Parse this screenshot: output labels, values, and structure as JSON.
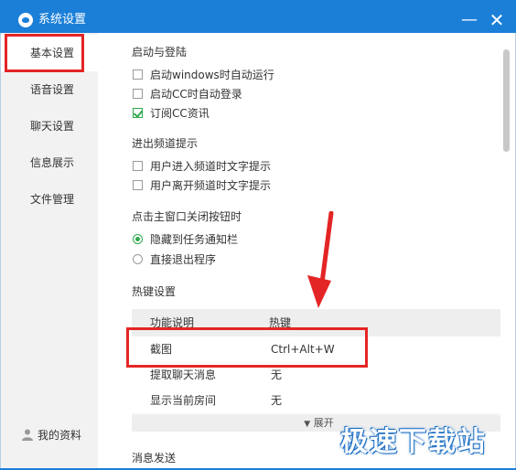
{
  "window": {
    "title": "系统设置"
  },
  "controls": {
    "minimize": "—",
    "close": "✕"
  },
  "sidebar": {
    "items": [
      {
        "label": "基本设置"
      },
      {
        "label": "语音设置"
      },
      {
        "label": "聊天设置"
      },
      {
        "label": "信息展示"
      },
      {
        "label": "文件管理"
      }
    ],
    "profile": "我的资料"
  },
  "sections": {
    "startup": {
      "title": "启动与登陆",
      "options": [
        "启动windows时自动运行",
        "启动CC时自动登录",
        "订阅CC资讯"
      ],
      "checked": [
        false,
        false,
        true
      ]
    },
    "channel": {
      "title": "进出频道提示",
      "options": [
        "用户进入频道时文字提示",
        "用户离开频道时文字提示"
      ]
    },
    "close": {
      "title": "点击主窗口关闭按钮时",
      "options": [
        "隐藏到任务通知栏",
        "直接退出程序"
      ],
      "selected": 0
    },
    "hotkeys": {
      "title": "热键设置",
      "headers": [
        "功能说明",
        "热键"
      ],
      "rows": [
        {
          "func": "截图",
          "key": "Ctrl+Alt+W"
        },
        {
          "func": "提取聊天消息",
          "key": "无"
        },
        {
          "func": "显示当前房间",
          "key": "无"
        }
      ],
      "expand": "展开"
    },
    "message": {
      "title": "消息发送"
    }
  },
  "watermark": "极速下载站"
}
